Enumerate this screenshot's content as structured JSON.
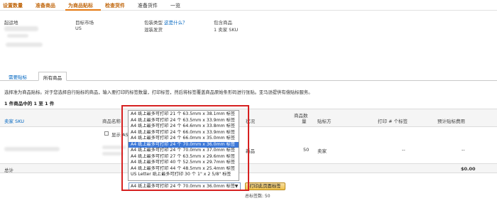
{
  "steps": [
    {
      "label": "设置数量"
    },
    {
      "label": "准备商品"
    },
    {
      "label": "为商品贴标"
    },
    {
      "label": "检查货件"
    },
    {
      "label": "准备货件"
    },
    {
      "label": "一览"
    }
  ],
  "info": {
    "ship_from_label": "起运地",
    "marketplace_label": "目标市场",
    "marketplace_value": "US",
    "packing_label": "包装类型",
    "packing_link": "这是什么？",
    "packing_value": "混装发货",
    "contains_label": "包含商品",
    "contains_value": "1 卖家 SKU"
  },
  "tabs": [
    {
      "label": "需要贴标"
    },
    {
      "label": "所有商品"
    }
  ],
  "description": "选择准为商品贴标。对于您选择自行贴标的商品，输入要打印的标签数量，打印标签，然后将标签覆盖商品原始条形码进行张贴。亚马逊提供有偿贴标服务。",
  "count_text": "1 件商品中的 1 至 1 件",
  "table": {
    "col_sku": "卖家 SKU",
    "col_name": "商品名称",
    "col_condition": "状况",
    "col_qty_1": "商品数",
    "col_qty_2": "量",
    "col_labeler": "贴标方",
    "col_print": "打印 # 个标签",
    "col_fee": "预计贴标费用",
    "show_asin_label": "显示 ASIN",
    "row": {
      "condition": "新品",
      "qty": "50",
      "labeler": "卖家",
      "print": "--",
      "fee": "--"
    },
    "total_label": "总计",
    "total_value": "$0.00"
  },
  "label_sizes": [
    "A4 纸上最多可打印 21 个 63.5mm x 38.1mm 标签",
    "A4 纸上最多可打印 24 个 63.5mm x 33.9mm 标签",
    "A4 纸上最多可打印 24 个 64.6mm x 33.8mm 标签",
    "A4 纸上最多可打印 24 个 66.0mm x 33.9mm 标签",
    "A4 纸上最多可打印 24 个 66.0mm x 35.0mm 标签",
    "A4 纸上最多可打印 24 个 70.0mm x 36.0mm 标签",
    "A4 纸上最多可打印 24 个 70.0mm x 37.0mm 标签",
    "A4 纸上最多可打印 27 个 63.5mm x 29.6mm 标签",
    "A4 纸上最多可打印 40 个 52.5mm x 29.7mm 标签",
    "A4 纸上最多可打印 44 个 48.5mm x 25.4mm 标签",
    "US Letter 纸上最多可打印 30 个 1\" x 2 5/8\" 标签"
  ],
  "selected_index": 5,
  "select_value": "A4 纸上最多可打印 24 个 70.0mm x 36.0mm 标签",
  "print_button": "打印此页面标签",
  "total_labels": "总标签数: 50",
  "colors": {
    "accent": "#e47911",
    "link": "#0066c0",
    "selected": "#3c78d8",
    "annotation": "#d62020"
  }
}
